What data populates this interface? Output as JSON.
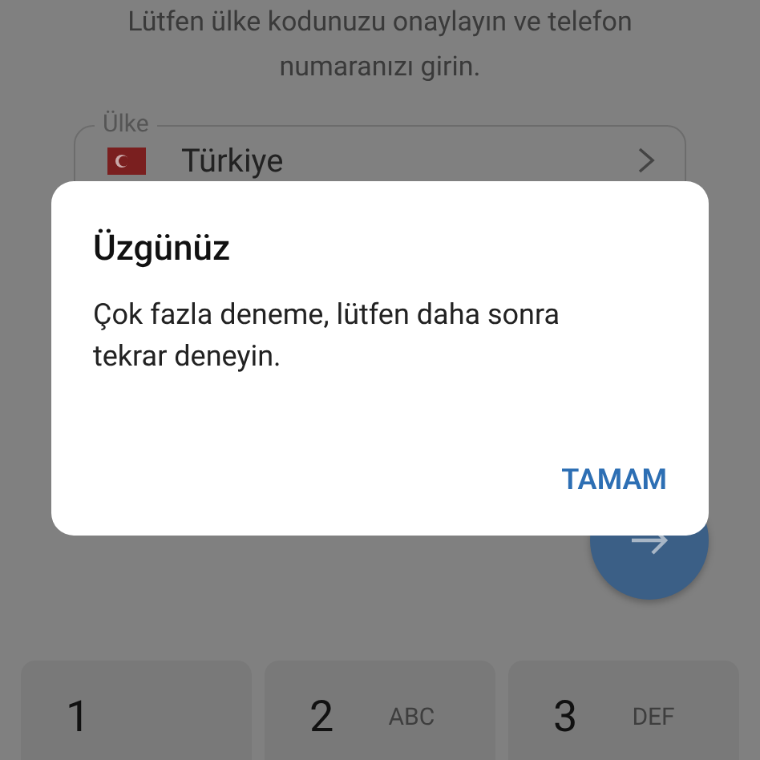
{
  "instruction": {
    "lines": [
      "Lütfen ülke kodunuzu onaylayın ve telefon",
      "numaranızı girin."
    ]
  },
  "country_field": {
    "label": "Ülke",
    "value": "Türkiye"
  },
  "dialog": {
    "title": "Üzgünüz",
    "message": "Çok fazla deneme, lütfen daha sonra tekrar deneyin.",
    "button": "TAMAM"
  },
  "keypad": [
    {
      "digit": "1"
    },
    {
      "digit": "2",
      "letters": "ABC"
    },
    {
      "digit": "3",
      "letters": "DEF"
    }
  ]
}
